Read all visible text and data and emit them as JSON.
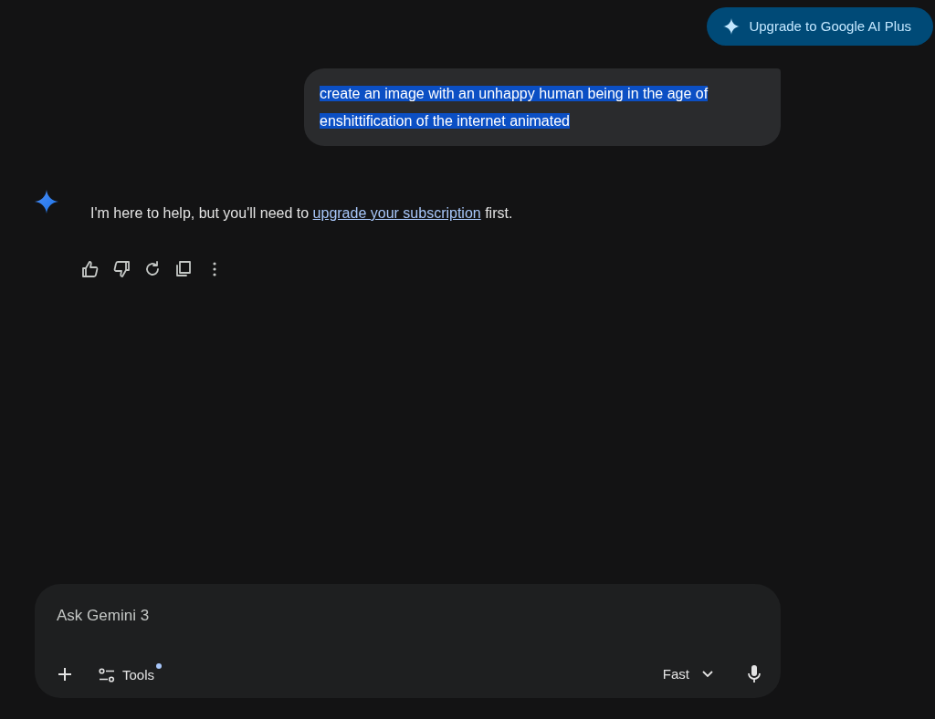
{
  "upgrade_button": {
    "label": "Upgrade to Google AI Plus"
  },
  "user_message": {
    "text": "create an image with an unhappy human being in the age of enshittification of the internet animated",
    "highlighted": true
  },
  "response": {
    "text_before": "I'm here to help, but you'll need to ",
    "link": "upgrade your subscription",
    "text_after": " first."
  },
  "response_actions": [
    {
      "kind": "thumbs-up"
    },
    {
      "kind": "thumbs-down"
    },
    {
      "kind": "redo"
    },
    {
      "kind": "copy"
    },
    {
      "kind": "more"
    }
  ],
  "prompt": {
    "placeholder": "Ask Gemini 3",
    "tools_label": "Tools",
    "tools_notification": true,
    "mode": "Fast"
  }
}
